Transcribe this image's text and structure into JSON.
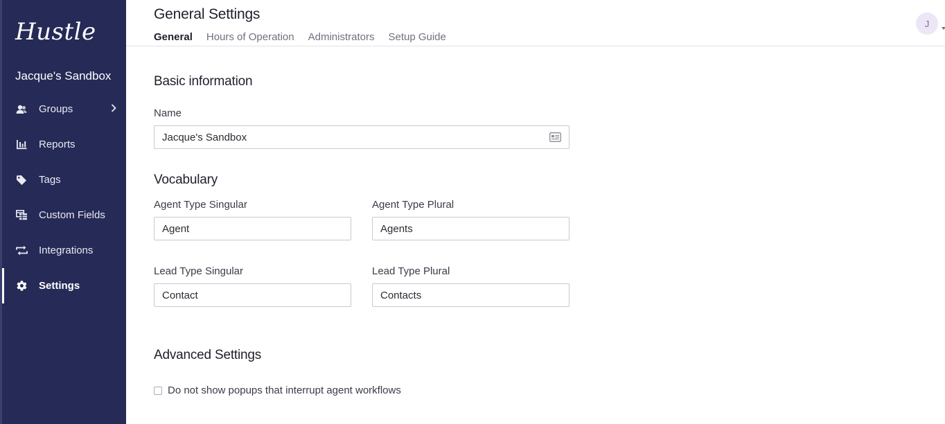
{
  "sidebar": {
    "logo": "Hustle",
    "workspace": "Jacque's Sandbox",
    "items": [
      {
        "label": "Groups",
        "icon": "groups-icon"
      },
      {
        "label": "Reports",
        "icon": "bar-chart-icon"
      },
      {
        "label": "Tags",
        "icon": "tag-icon"
      },
      {
        "label": "Custom Fields",
        "icon": "table-icon"
      },
      {
        "label": "Integrations",
        "icon": "sync-arrows-icon"
      },
      {
        "label": "Settings",
        "icon": "gear-icon",
        "active": true
      }
    ]
  },
  "header": {
    "title": "General Settings",
    "tabs": [
      {
        "label": "General",
        "active": true
      },
      {
        "label": "Hours of Operation"
      },
      {
        "label": "Administrators"
      },
      {
        "label": "Setup Guide"
      }
    ],
    "avatar_initial": "J"
  },
  "basic": {
    "title": "Basic information",
    "name_label": "Name",
    "name_value": "Jacque's Sandbox"
  },
  "vocabulary": {
    "title": "Vocabulary",
    "agent_singular_label": "Agent Type Singular",
    "agent_singular_value": "Agent",
    "agent_plural_label": "Agent Type Plural",
    "agent_plural_value": "Agents",
    "lead_singular_label": "Lead Type Singular",
    "lead_singular_value": "Contact",
    "lead_plural_label": "Lead Type Plural",
    "lead_plural_value": "Contacts"
  },
  "advanced": {
    "title": "Advanced Settings",
    "popup_checkbox_label": "Do not show popups that interrupt agent workflows",
    "popup_checkbox_checked": false
  },
  "colors": {
    "sidebar_bg": "#262a56",
    "accent_text": "#1e1f2b",
    "avatar_bg": "#ece6f7"
  }
}
